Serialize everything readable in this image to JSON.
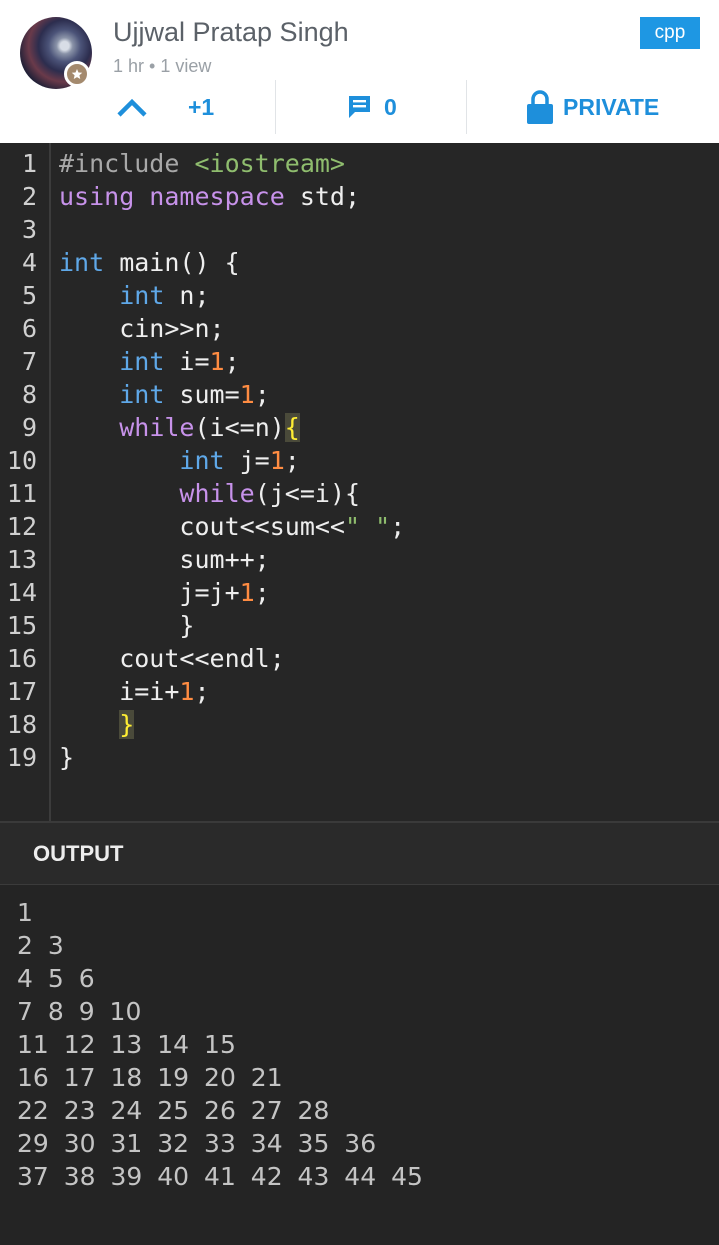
{
  "header": {
    "user_name": "Ujjwal Pratap Singh",
    "meta": "1 hr • 1 view",
    "language": "cpp",
    "votes": "+1",
    "comments": "0",
    "privacy": "PRIVATE",
    "icons": [
      "upvote-icon",
      "comment-icon",
      "lock-icon",
      "star-icon"
    ],
    "accent_color": "#1e8fdb"
  },
  "code": {
    "line_numbers": [
      "1",
      "2",
      "3",
      "4",
      "5",
      "6",
      "7",
      "8",
      "9",
      "10",
      "11",
      "12",
      "13",
      "14",
      "15",
      "16",
      "17",
      "18",
      "19"
    ],
    "lines": [
      [
        {
          "t": "#include ",
          "c": "pre"
        },
        {
          "t": "<iostream>",
          "c": "str"
        }
      ],
      [
        {
          "t": "using namespace",
          "c": "kw"
        },
        {
          "t": " std;",
          "c": "id"
        }
      ],
      [],
      [
        {
          "t": "int",
          "c": "type"
        },
        {
          "t": " main() {",
          "c": "id"
        }
      ],
      [
        {
          "t": "    ",
          "c": "id"
        },
        {
          "t": "int",
          "c": "type"
        },
        {
          "t": " n;",
          "c": "id"
        }
      ],
      [
        {
          "t": "    cin>>n;",
          "c": "id"
        }
      ],
      [
        {
          "t": "    ",
          "c": "id"
        },
        {
          "t": "int",
          "c": "type"
        },
        {
          "t": " i=",
          "c": "id"
        },
        {
          "t": "1",
          "c": "num"
        },
        {
          "t": ";",
          "c": "id"
        }
      ],
      [
        {
          "t": "    ",
          "c": "id"
        },
        {
          "t": "int",
          "c": "type"
        },
        {
          "t": " sum=",
          "c": "id"
        },
        {
          "t": "1",
          "c": "num"
        },
        {
          "t": ";",
          "c": "id"
        }
      ],
      [
        {
          "t": "    ",
          "c": "id"
        },
        {
          "t": "while",
          "c": "kw"
        },
        {
          "t": "(i<=n)",
          "c": "id"
        },
        {
          "t": "{",
          "c": "match"
        }
      ],
      [
        {
          "t": "        ",
          "c": "id"
        },
        {
          "t": "int",
          "c": "type"
        },
        {
          "t": " j=",
          "c": "id"
        },
        {
          "t": "1",
          "c": "num"
        },
        {
          "t": ";",
          "c": "id"
        }
      ],
      [
        {
          "t": "        ",
          "c": "id"
        },
        {
          "t": "while",
          "c": "kw"
        },
        {
          "t": "(j<=i){",
          "c": "id"
        }
      ],
      [
        {
          "t": "        cout<<sum<<",
          "c": "id"
        },
        {
          "t": "\" \"",
          "c": "str"
        },
        {
          "t": ";",
          "c": "id"
        }
      ],
      [
        {
          "t": "        sum++;",
          "c": "id"
        }
      ],
      [
        {
          "t": "        j=j+",
          "c": "id"
        },
        {
          "t": "1",
          "c": "num"
        },
        {
          "t": ";",
          "c": "id"
        }
      ],
      [
        {
          "t": "        }",
          "c": "id"
        }
      ],
      [
        {
          "t": "    cout<<endl;",
          "c": "id"
        }
      ],
      [
        {
          "t": "    i=i+",
          "c": "id"
        },
        {
          "t": "1",
          "c": "num"
        },
        {
          "t": ";",
          "c": "id"
        }
      ],
      [
        {
          "t": "    ",
          "c": "id"
        },
        {
          "t": "}",
          "c": "match"
        }
      ],
      [
        {
          "t": "}",
          "c": "id"
        }
      ]
    ],
    "colors": {
      "pre": "#a8a8a8",
      "str": "#8fbd6e",
      "kw": "#c792ea",
      "type": "#5fa8e8",
      "num": "#ff8c42",
      "id": "#eeeeee",
      "match": "#ffee33",
      "match_bg": "#4a4a3a"
    }
  },
  "output": {
    "title": "OUTPUT",
    "lines": [
      "1",
      "2 3",
      "4 5 6",
      "7 8 9 10",
      "11 12 13 14 15",
      "16 17 18 19 20 21",
      "22 23 24 25 26 27 28",
      "29 30 31 32 33 34 35 36",
      "37 38 39 40 41 42 43 44 45"
    ]
  }
}
